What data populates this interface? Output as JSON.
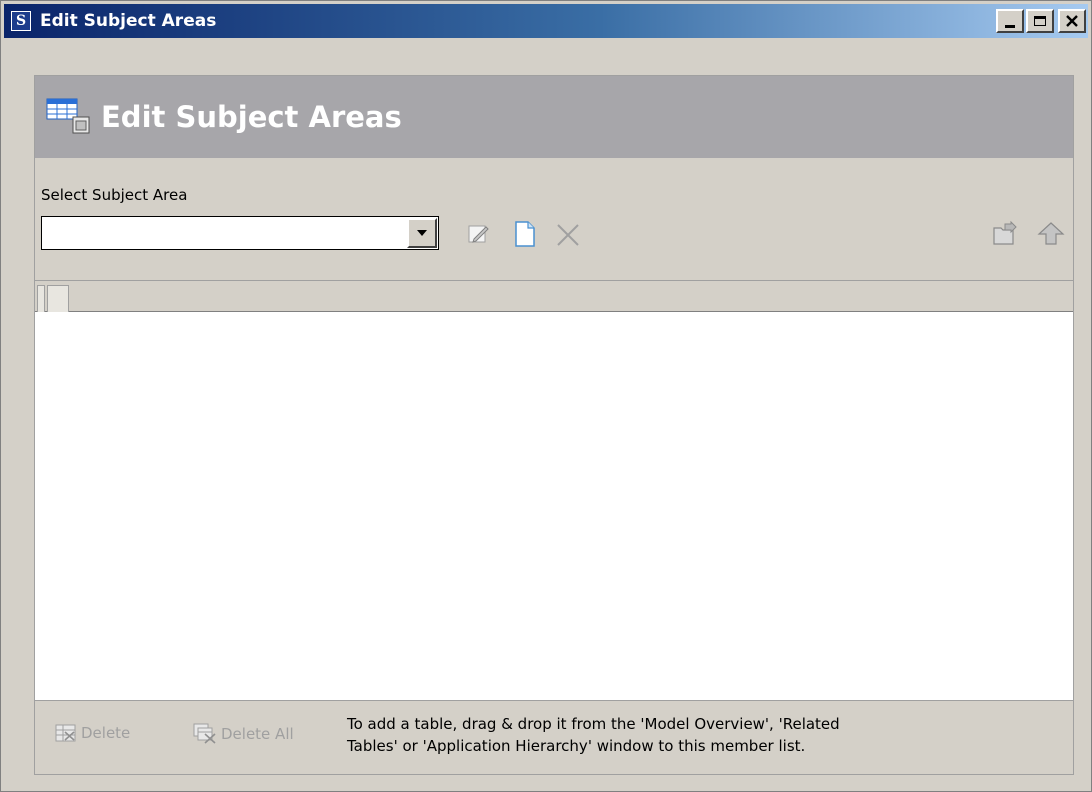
{
  "window": {
    "title": "Edit Subject Areas",
    "icon_letter": "S",
    "controls": {
      "minimize": "_",
      "maximize": "□",
      "close": "X"
    }
  },
  "header": {
    "title": "Edit Subject Areas",
    "icon": "subject-area-table-icon"
  },
  "selector": {
    "label": "Select Subject Area",
    "value": "",
    "toolbar": [
      "edit-icon",
      "new-document-icon",
      "delete-x-icon"
    ],
    "right_toolbar": [
      "open-folder-icon",
      "up-arrow-icon"
    ]
  },
  "footer": {
    "delete_label": "Delete",
    "delete_all_label": "Delete All",
    "hint_line1": "To add a table, drag & drop it from the 'Model Overview', 'Related",
    "hint_line2": "Tables' or 'Application Hierarchy'  window to this member list."
  },
  "colors": {
    "titlebar_start": "#0a246a",
    "header_band": "#a7a6aa",
    "disabled_text": "#a0a0a0"
  }
}
